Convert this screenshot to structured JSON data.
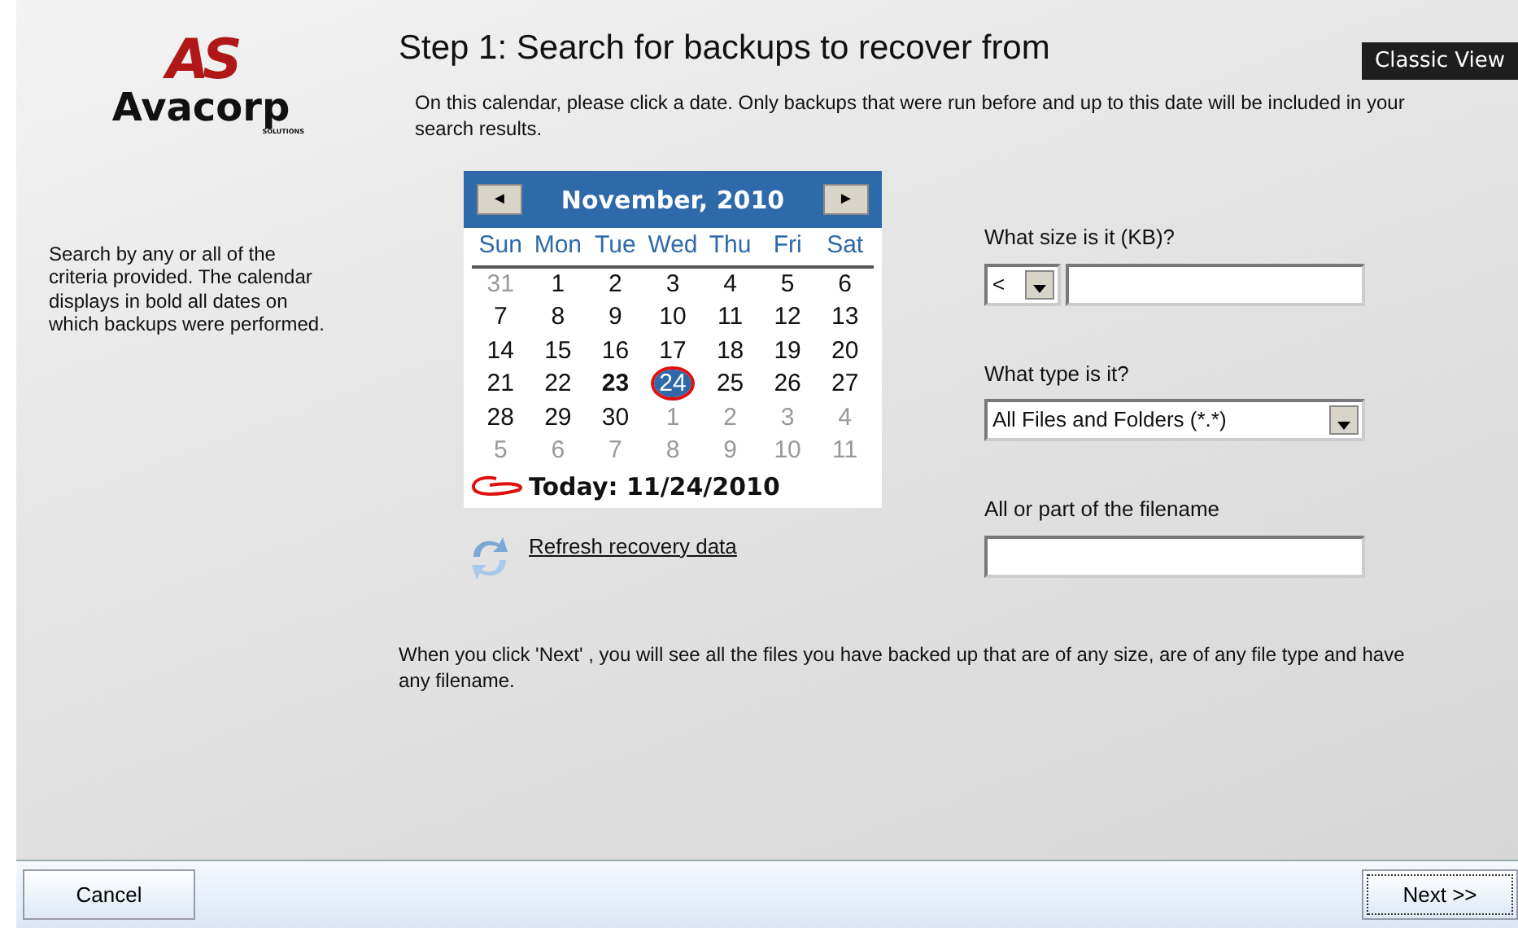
{
  "logo": {
    "mark": "AS",
    "name": "Avacorp",
    "tagline": "SOLUTIONS"
  },
  "sidebar_help": "Search by any or all of the criteria provided. The calendar displays in bold all dates on which backups were performed.",
  "title": "Step 1: Search for backups to recover from",
  "view_button": "Classic View",
  "intro": "On this calendar, please click a date. Only backups that were run before and up to this date will be included in your search results.",
  "calendar": {
    "prev": "◄",
    "month": "November, 2010",
    "next": "►",
    "weekdays": [
      "Sun",
      "Mon",
      "Tue",
      "Wed",
      "Thu",
      "Fri",
      "Sat"
    ],
    "weeks": [
      [
        {
          "day": "31",
          "kind": "other",
          "bold": false,
          "selected": false
        },
        {
          "day": "1",
          "kind": "current",
          "bold": false,
          "selected": false
        },
        {
          "day": "2",
          "kind": "current",
          "bold": false,
          "selected": false
        },
        {
          "day": "3",
          "kind": "current",
          "bold": false,
          "selected": false
        },
        {
          "day": "4",
          "kind": "current",
          "bold": false,
          "selected": false
        },
        {
          "day": "5",
          "kind": "current",
          "bold": false,
          "selected": false
        },
        {
          "day": "6",
          "kind": "current",
          "bold": false,
          "selected": false
        }
      ],
      [
        {
          "day": "7",
          "kind": "current",
          "bold": false,
          "selected": false
        },
        {
          "day": "8",
          "kind": "current",
          "bold": false,
          "selected": false
        },
        {
          "day": "9",
          "kind": "current",
          "bold": false,
          "selected": false
        },
        {
          "day": "10",
          "kind": "current",
          "bold": false,
          "selected": false
        },
        {
          "day": "11",
          "kind": "current",
          "bold": false,
          "selected": false
        },
        {
          "day": "12",
          "kind": "current",
          "bold": false,
          "selected": false
        },
        {
          "day": "13",
          "kind": "current",
          "bold": false,
          "selected": false
        }
      ],
      [
        {
          "day": "14",
          "kind": "current",
          "bold": false,
          "selected": false
        },
        {
          "day": "15",
          "kind": "current",
          "bold": false,
          "selected": false
        },
        {
          "day": "16",
          "kind": "current",
          "bold": false,
          "selected": false
        },
        {
          "day": "17",
          "kind": "current",
          "bold": false,
          "selected": false
        },
        {
          "day": "18",
          "kind": "current",
          "bold": false,
          "selected": false
        },
        {
          "day": "19",
          "kind": "current",
          "bold": false,
          "selected": false
        },
        {
          "day": "20",
          "kind": "current",
          "bold": false,
          "selected": false
        }
      ],
      [
        {
          "day": "21",
          "kind": "current",
          "bold": false,
          "selected": false
        },
        {
          "day": "22",
          "kind": "current",
          "bold": false,
          "selected": false
        },
        {
          "day": "23",
          "kind": "current",
          "bold": true,
          "selected": false
        },
        {
          "day": "24",
          "kind": "current",
          "bold": false,
          "selected": true
        },
        {
          "day": "25",
          "kind": "current",
          "bold": false,
          "selected": false
        },
        {
          "day": "26",
          "kind": "current",
          "bold": false,
          "selected": false
        },
        {
          "day": "27",
          "kind": "current",
          "bold": false,
          "selected": false
        }
      ],
      [
        {
          "day": "28",
          "kind": "current",
          "bold": false,
          "selected": false
        },
        {
          "day": "29",
          "kind": "current",
          "bold": false,
          "selected": false
        },
        {
          "day": "30",
          "kind": "current",
          "bold": false,
          "selected": false
        },
        {
          "day": "1",
          "kind": "other",
          "bold": false,
          "selected": false
        },
        {
          "day": "2",
          "kind": "other",
          "bold": false,
          "selected": false
        },
        {
          "day": "3",
          "kind": "other",
          "bold": false,
          "selected": false
        },
        {
          "day": "4",
          "kind": "other",
          "bold": false,
          "selected": false
        }
      ],
      [
        {
          "day": "5",
          "kind": "other",
          "bold": false,
          "selected": false
        },
        {
          "day": "6",
          "kind": "other",
          "bold": false,
          "selected": false
        },
        {
          "day": "7",
          "kind": "other",
          "bold": false,
          "selected": false
        },
        {
          "day": "8",
          "kind": "other",
          "bold": false,
          "selected": false
        },
        {
          "day": "9",
          "kind": "other",
          "bold": false,
          "selected": false
        },
        {
          "day": "10",
          "kind": "other",
          "bold": false,
          "selected": false
        },
        {
          "day": "11",
          "kind": "other",
          "bold": false,
          "selected": false
        }
      ]
    ],
    "today": "Today: 11/24/2010"
  },
  "refresh_link": "Refresh recovery data",
  "size": {
    "label": "What size is it (KB)?",
    "operator": "<"
  },
  "type": {
    "label": "What type is it?",
    "value": "All Files and Folders (*.*)"
  },
  "filename": {
    "label": "All or part of the filename"
  },
  "summary": "When you click 'Next' , you will see all the files you have backed up that are of any size, are of any file type and have any filename.",
  "footer": {
    "cancel": "Cancel",
    "next": "Next >>"
  }
}
